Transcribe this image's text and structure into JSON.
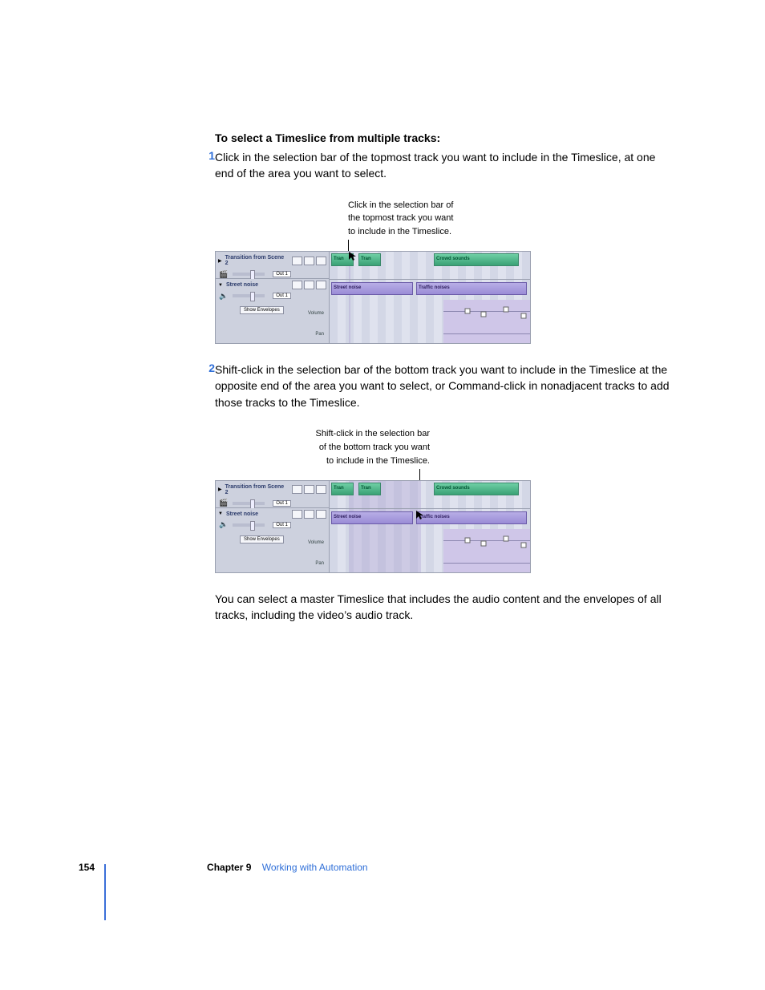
{
  "heading": "To select a Timeslice from multiple tracks:",
  "steps": [
    {
      "num": "1",
      "text": "Click in the selection bar of the topmost track you want to include in the Timeslice, at one end of the area you want to select."
    },
    {
      "num": "2",
      "text": "Shift-click in the selection bar of the bottom track you want to include in the Timeslice at the opposite end of the area you want to select, or Command-click in nonadjacent tracks to add those tracks to the Timeslice."
    }
  ],
  "figure1": {
    "callout_line1": "Click in the selection bar of",
    "callout_line2": "the topmost track you want",
    "callout_line3": "to include in the Timeslice.",
    "track1_name": "Transition from Scene 2",
    "track2_name": "Street noise",
    "out_label": "Out 1",
    "show_env": "Show Envelopes",
    "volume": "Volume",
    "pan": "Pan",
    "clip_a": "Tran",
    "clip_b": "Tran",
    "clip_c": "Crowd sounds",
    "clip_d": "Street noise",
    "clip_e": "Traffic noises"
  },
  "figure2": {
    "callout_line1": "Shift-click in the selection bar",
    "callout_line2": "of the bottom track you want",
    "callout_line3": "to include in the Timeslice.",
    "track1_name": "Transition from Scene 2",
    "track2_name": "Street noise",
    "out_label": "Out 1",
    "show_env": "Show Envelopes",
    "volume": "Volume",
    "pan": "Pan",
    "clip_a": "Tran",
    "clip_b": "Tran",
    "clip_c": "Crowd sounds",
    "clip_d": "Street noise",
    "clip_e": "Traffic noises"
  },
  "closing_para": "You can select a master Timeslice that includes the audio content and the envelopes of all tracks, including the video’s audio track.",
  "footer": {
    "page": "154",
    "chapter_label": "Chapter 9",
    "chapter_title": "Working with Automation"
  }
}
